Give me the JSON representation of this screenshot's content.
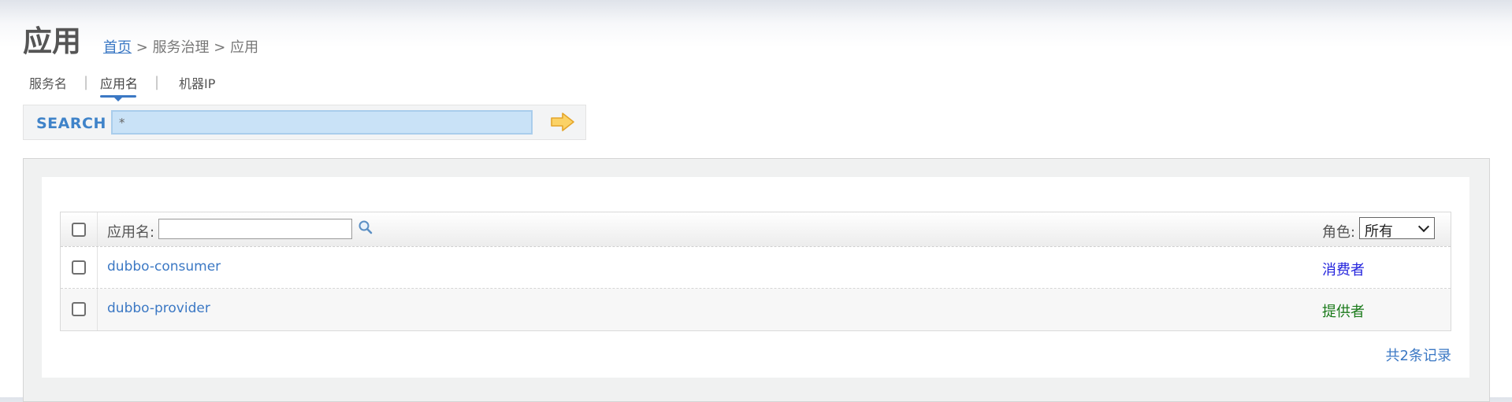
{
  "page": {
    "title": "应用"
  },
  "breadcrumb": {
    "home": "首页",
    "sep1": ">",
    "section": "服务治理",
    "sep2": ">",
    "current": "应用"
  },
  "tabs": [
    {
      "label": "服务名",
      "active": false
    },
    {
      "label": "应用名",
      "active": true
    },
    {
      "label": "机器IP",
      "active": false
    }
  ],
  "tab_separator": "|",
  "search": {
    "label": "SEARCH",
    "value": "*",
    "go_icon": "arrow-right-icon"
  },
  "table": {
    "filter_label": "应用名:",
    "filter_value": "",
    "filter_icon": "search-icon",
    "role_label": "角色:",
    "role_selected": "所有",
    "rows": [
      {
        "name": "dubbo-consumer",
        "role": "消费者",
        "role_color": "#2222dd"
      },
      {
        "name": "dubbo-provider",
        "role": "提供者",
        "role_color": "#1a7a1a"
      }
    ],
    "total": "共2条记录"
  },
  "colors": {
    "accent": "#3b78c4",
    "search_input_bg": "#c9e2f7"
  }
}
